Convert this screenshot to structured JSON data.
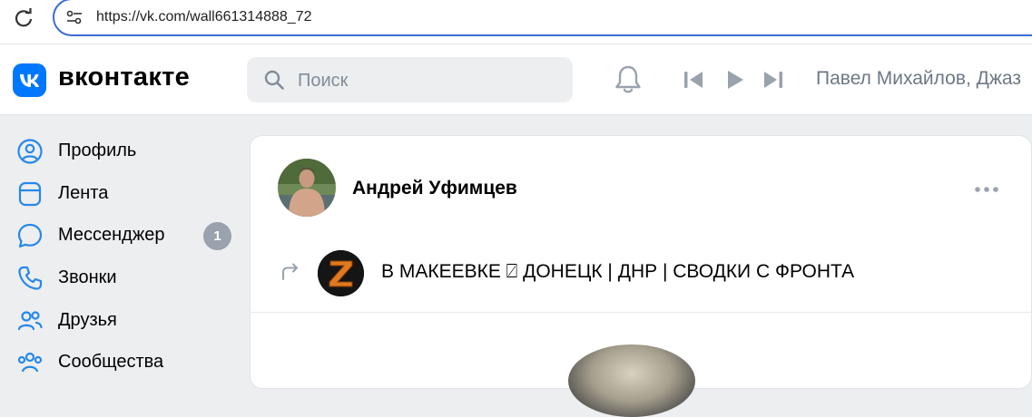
{
  "browser": {
    "url": "https://vk.com/wall661314888_72"
  },
  "header": {
    "logo_text": "вконтакте",
    "search_placeholder": "Поиск",
    "now_playing": "Павел Михайлов, Джаз"
  },
  "sidebar": {
    "items": [
      {
        "label": "Профиль",
        "icon": "profile-icon"
      },
      {
        "label": "Лента",
        "icon": "feed-icon"
      },
      {
        "label": "Мессенджер",
        "icon": "messenger-icon",
        "badge": "1"
      },
      {
        "label": "Звонки",
        "icon": "phone-icon"
      },
      {
        "label": "Друзья",
        "icon": "friends-icon"
      },
      {
        "label": "Сообщества",
        "icon": "communities-icon"
      }
    ]
  },
  "post": {
    "author": "Андрей Уфимцев",
    "repost_group": "В МАКЕЕВКЕ ⍁ ДОНЕЦК | ДНР | СВОДКИ С ФРОНТА"
  },
  "colors": {
    "accent": "#0077ff",
    "badge": "#99a2ad",
    "background": "#edeef0"
  }
}
